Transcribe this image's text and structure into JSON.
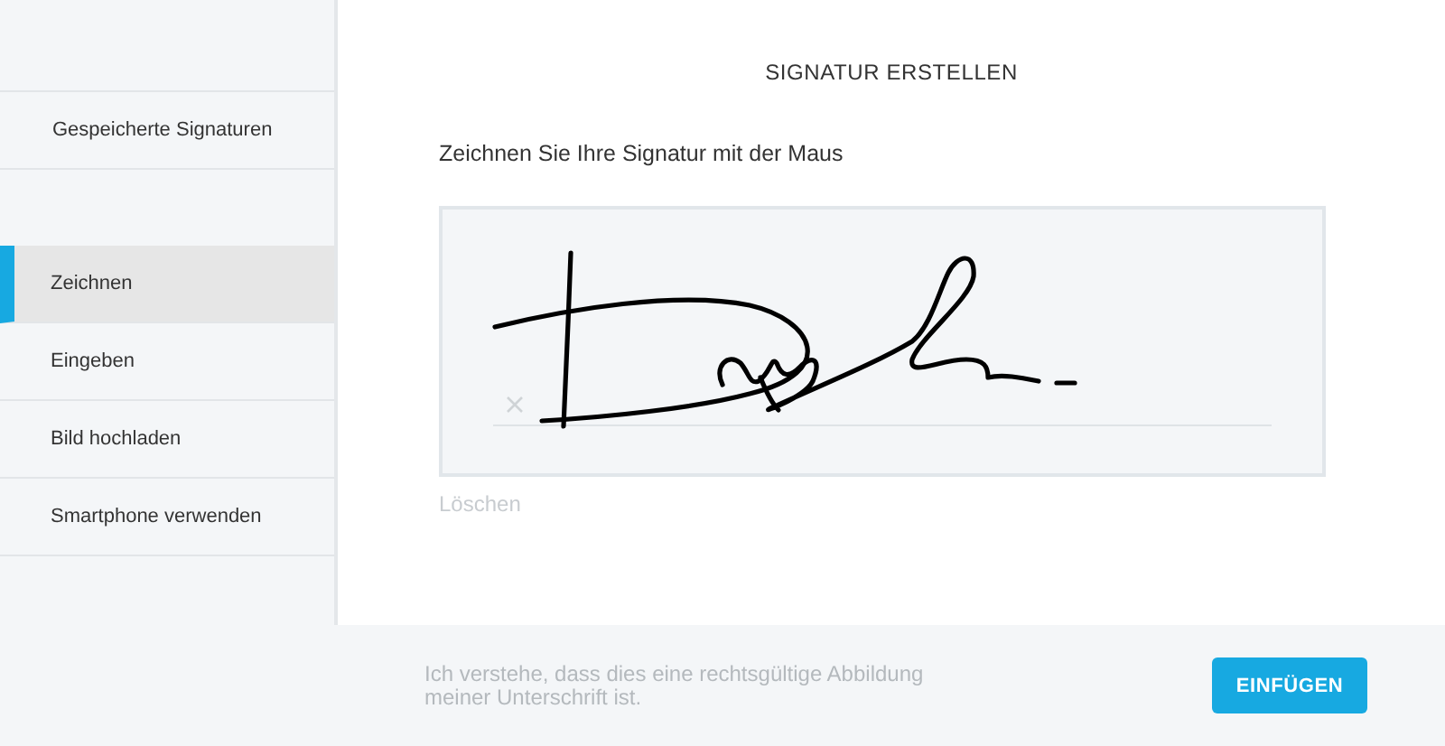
{
  "sidebar": {
    "saved_link": "Gespeicherte Signaturen",
    "items": [
      {
        "label": "Zeichnen",
        "selected": true
      },
      {
        "label": "Eingeben",
        "selected": false
      },
      {
        "label": "Bild hochladen",
        "selected": false
      },
      {
        "label": "Smartphone verwenden",
        "selected": false
      }
    ]
  },
  "dialog": {
    "title": "SIGNATUR ERSTELLEN",
    "instruction": "Zeichnen Sie Ihre Signatur mit der Maus",
    "clear_link": "Löschen"
  },
  "footer": {
    "notice": "Ich verstehe, dass dies eine rechtsgültige Abbildung meiner Unterschrift ist.",
    "button": "EINFÜGEN"
  }
}
